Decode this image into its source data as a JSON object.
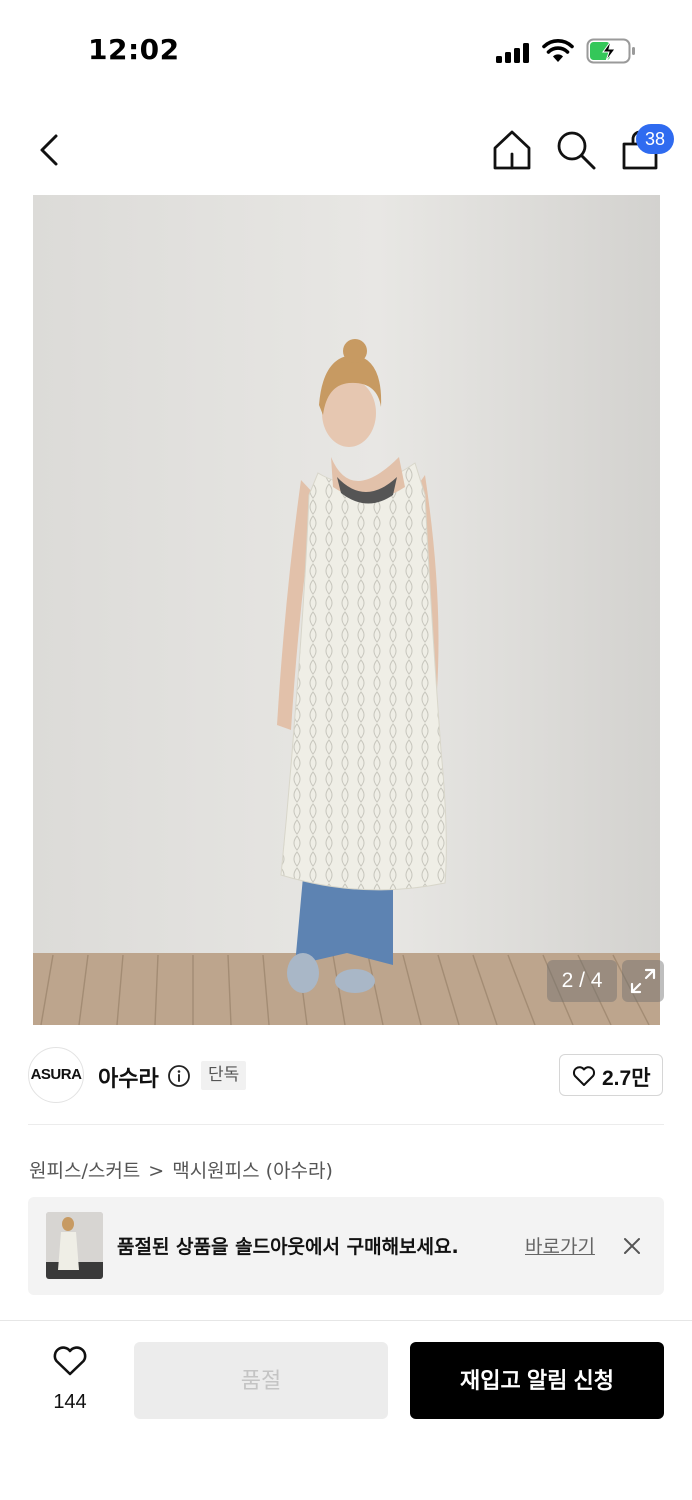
{
  "status_bar": {
    "time": "12:02"
  },
  "header": {
    "cart_badge": "38",
    "icons": [
      "back-icon",
      "home-icon",
      "search-icon",
      "shopping-bag-icon"
    ]
  },
  "gallery": {
    "counter": "2 / 4",
    "current_index": 2,
    "total": 4
  },
  "brand": {
    "logo_text": "ASURA",
    "name": "아수라",
    "badge": "단독",
    "likes": "2.7만"
  },
  "breadcrumb": {
    "items": [
      "원피스/스커트",
      "맥시원피스 (아수라)"
    ],
    "separator": ">"
  },
  "soldout_banner": {
    "text": "품절된 상품을 솔드아웃에서 구매해보세요.",
    "link": "바로가기"
  },
  "bottom_bar": {
    "wish_count": "144",
    "soldout_label": "품절",
    "restock_label": "재입고 알림 신청"
  },
  "colors": {
    "accent": "#2f6bf0",
    "primary_button": "#000000",
    "disabled_button": "#ececec"
  }
}
